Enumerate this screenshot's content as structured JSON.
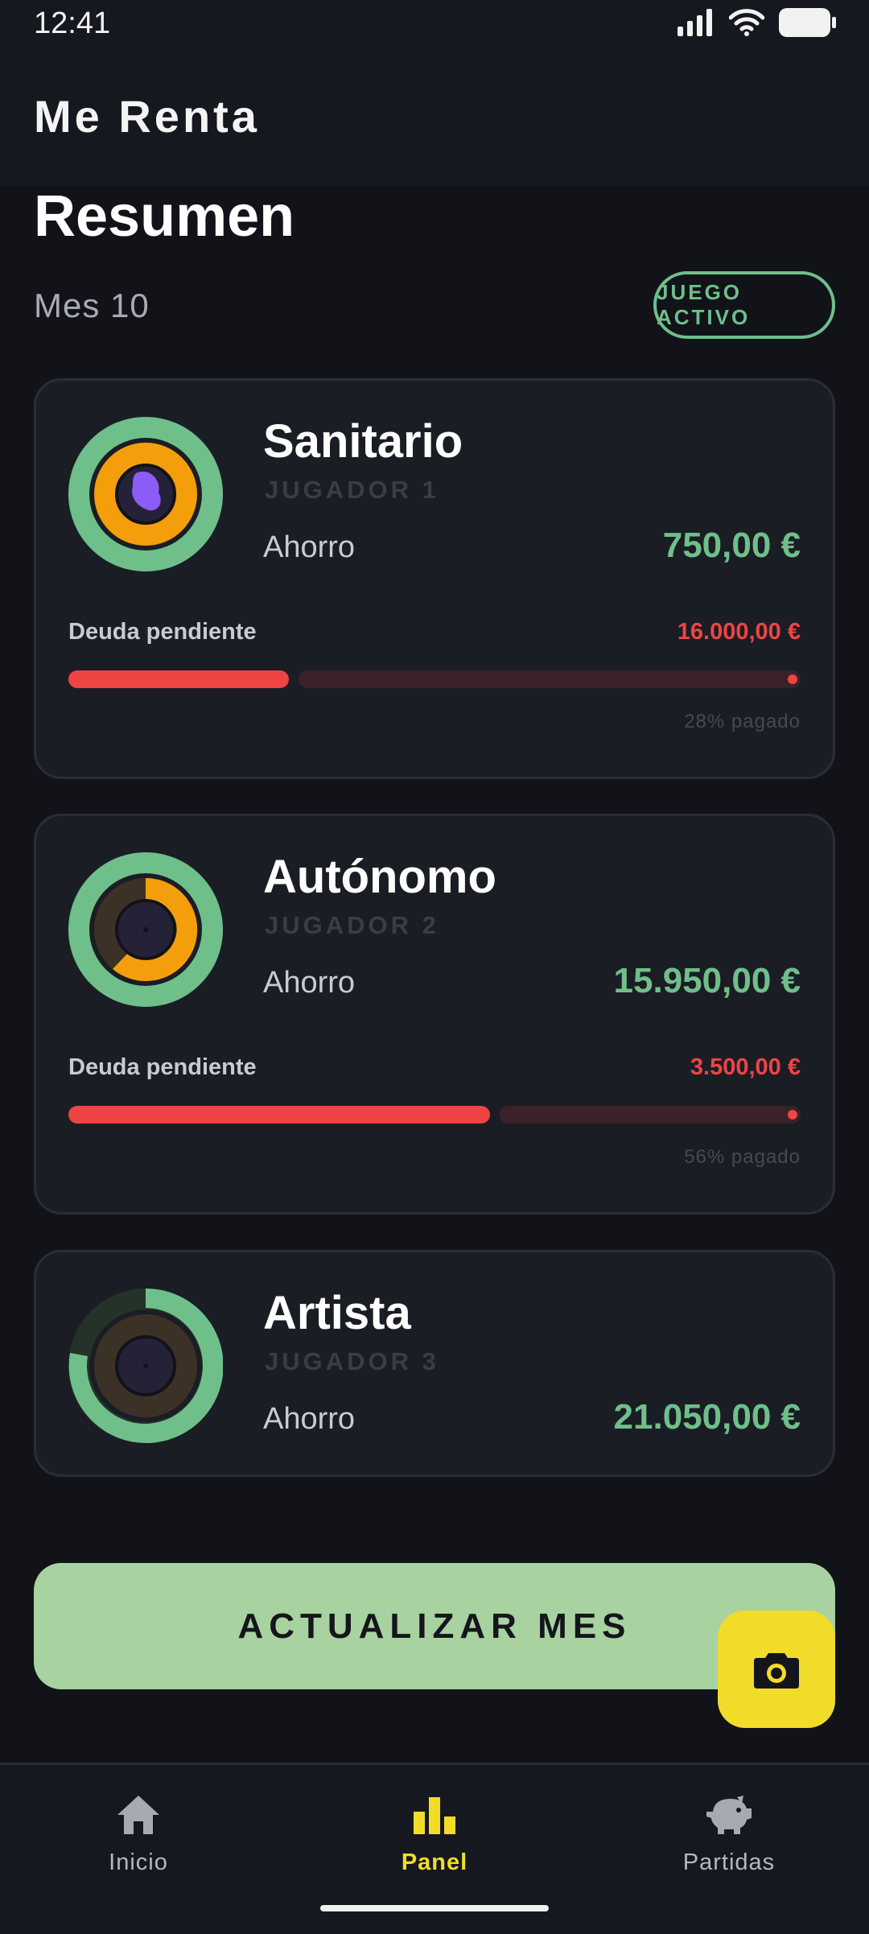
{
  "status_bar": {
    "time": "12:41"
  },
  "app": {
    "title": "Me Renta"
  },
  "summary": {
    "title": "Resumen",
    "month": "Mes 10",
    "badge": "JUEGO ACTIVO"
  },
  "players": [
    {
      "name": "Sanitario",
      "label": "JUGADOR 1",
      "savings_label": "Ahorro",
      "savings": "750,00 €",
      "debt_label": "Deuda pendiente",
      "debt": "16.000,00 €",
      "paid_text": "28% pagado",
      "paid_fraction": 0.28
    },
    {
      "name": "Autónomo",
      "label": "JUGADOR 2",
      "savings_label": "Ahorro",
      "savings": "15.950,00 €",
      "debt_label": "Deuda pendiente",
      "debt": "3.500,00 €",
      "paid_text": "56% pagado",
      "paid_fraction": 0.56
    },
    {
      "name": "Artista",
      "label": "JUGADOR 3",
      "savings_label": "Ahorro",
      "savings": "21.050,00 €"
    }
  ],
  "actions": {
    "update_month": "ACTUALIZAR MES",
    "camera_icon": "camera-icon"
  },
  "nav": {
    "items": [
      {
        "label": "Inicio",
        "icon": "home-icon",
        "active": false
      },
      {
        "label": "Panel",
        "icon": "bar-chart-icon",
        "active": true
      },
      {
        "label": "Partidas",
        "icon": "piggy-bank-icon",
        "active": false
      }
    ]
  },
  "colors": {
    "background": "#111319",
    "card": "#1b1d25",
    "accent_green": "#6fbf8a",
    "debt_red": "#ef4444",
    "highlight_yellow": "#f2dc2a",
    "cta_green": "#a8d2a0"
  }
}
